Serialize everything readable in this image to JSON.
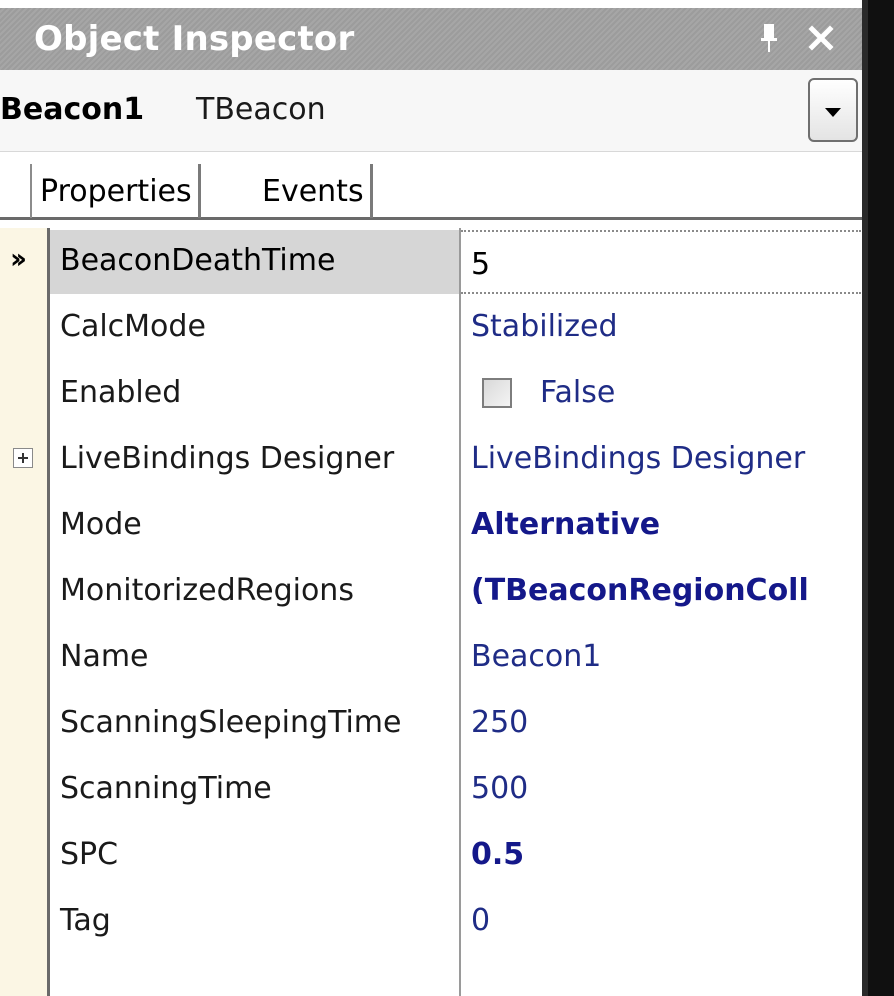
{
  "window": {
    "title": "Object Inspector",
    "pin_icon": "pin-icon",
    "close_icon": "close-icon"
  },
  "selector": {
    "component_name": "Beacon1",
    "component_type": "TBeacon",
    "dropdown_icon": "chevron-down-icon"
  },
  "tabs": [
    {
      "label": "Properties",
      "active": true
    },
    {
      "label": "Events",
      "active": false
    }
  ],
  "properties": [
    {
      "name": "BeaconDeathTime",
      "value": "5",
      "selected": true
    },
    {
      "name": "CalcMode",
      "value": "Stabilized"
    },
    {
      "name": "Enabled",
      "value": "False",
      "checkbox": true,
      "checked": false
    },
    {
      "name": "LiveBindings Designer",
      "value": "LiveBindings Designer",
      "expandable": true
    },
    {
      "name": "Mode",
      "value": "Alternative",
      "bold": true
    },
    {
      "name": "MonitorizedRegions",
      "value": "(TBeaconRegionColl",
      "bold": true
    },
    {
      "name": "Name",
      "value": "Beacon1"
    },
    {
      "name": "ScanningSleepingTime",
      "value": "250"
    },
    {
      "name": "ScanningTime",
      "value": "500"
    },
    {
      "name": "SPC",
      "value": "0.5",
      "bold": true
    },
    {
      "name": "Tag",
      "value": "0"
    }
  ],
  "colors": {
    "title_bar": "#a0a0a0",
    "gutter": "#fbf6e4",
    "value_text": "#1f2c86",
    "selected_row": "#d6d6d6"
  }
}
